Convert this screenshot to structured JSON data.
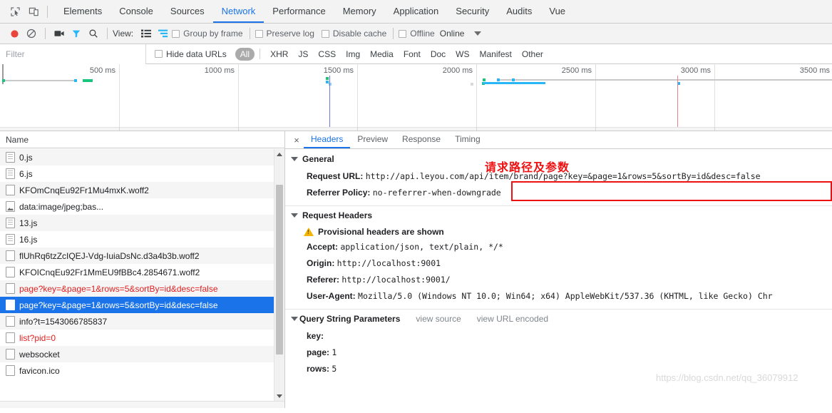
{
  "devtools": {
    "icons": {
      "inspect": "inspect-element-icon",
      "device": "device-toolbar-icon"
    },
    "tabs": [
      {
        "label": "Elements",
        "active": false
      },
      {
        "label": "Console",
        "active": false
      },
      {
        "label": "Sources",
        "active": false
      },
      {
        "label": "Network",
        "active": true
      },
      {
        "label": "Performance",
        "active": false
      },
      {
        "label": "Memory",
        "active": false
      },
      {
        "label": "Application",
        "active": false
      },
      {
        "label": "Security",
        "active": false
      },
      {
        "label": "Audits",
        "active": false
      },
      {
        "label": "Vue",
        "active": false
      }
    ]
  },
  "controlbar": {
    "record_icon": "record-icon",
    "clear_icon": "clear-icon",
    "camera_icon": "capture-screenshots-icon",
    "filter_icon": "filter-icon",
    "search_icon": "search-icon",
    "view_label": "View:",
    "view_list_icon": "list-view-icon",
    "view_waterfall_icon": "waterfall-view-icon",
    "group_by_frame": "Group by frame",
    "preserve_log": "Preserve log",
    "disable_cache": "Disable cache",
    "offline": "Offline",
    "online": "Online",
    "throttle_caret_icon": "chevron-down-icon"
  },
  "filterbar": {
    "placeholder": "Filter",
    "value": "",
    "hide_data_urls": "Hide data URLs",
    "types": [
      {
        "label": "All",
        "selected": true
      },
      {
        "label": "XHR",
        "selected": false
      },
      {
        "label": "JS",
        "selected": false
      },
      {
        "label": "CSS",
        "selected": false
      },
      {
        "label": "Img",
        "selected": false
      },
      {
        "label": "Media",
        "selected": false
      },
      {
        "label": "Font",
        "selected": false
      },
      {
        "label": "Doc",
        "selected": false
      },
      {
        "label": "WS",
        "selected": false
      },
      {
        "label": "Manifest",
        "selected": false
      },
      {
        "label": "Other",
        "selected": false
      }
    ]
  },
  "overview": {
    "ticks": [
      "500 ms",
      "1000 ms",
      "1500 ms",
      "2000 ms",
      "2500 ms",
      "3000 ms",
      "3500 ms"
    ]
  },
  "requests": {
    "column_header": "Name",
    "rows": [
      {
        "name": "0.js",
        "icon": "js-file-icon",
        "error": false,
        "selected": false
      },
      {
        "name": "6.js",
        "icon": "js-file-icon",
        "error": false,
        "selected": false
      },
      {
        "name": "KFOmCnqEu92Fr1Mu4mxK.woff2",
        "icon": "font-file-icon",
        "error": false,
        "selected": false
      },
      {
        "name": "data:image/jpeg;bas...",
        "icon": "image-file-icon",
        "error": false,
        "selected": false
      },
      {
        "name": "13.js",
        "icon": "js-file-icon",
        "error": false,
        "selected": false
      },
      {
        "name": "16.js",
        "icon": "js-file-icon",
        "error": false,
        "selected": false
      },
      {
        "name": "flUhRq6tzZcIQEJ-Vdg-IuiaDsNc.d3a4b3b.woff2",
        "icon": "font-file-icon",
        "error": false,
        "selected": false
      },
      {
        "name": "KFOICnqEu92Fr1MmEU9fBBc4.2854671.woff2",
        "icon": "font-file-icon",
        "error": false,
        "selected": false
      },
      {
        "name": "page?key=&page=1&rows=5&sortBy=id&desc=false",
        "icon": "xhr-file-icon",
        "error": true,
        "selected": false
      },
      {
        "name": "page?key=&page=1&rows=5&sortBy=id&desc=false",
        "icon": "xhr-file-icon",
        "error": true,
        "selected": true
      },
      {
        "name": "info?t=1543066785837",
        "icon": "xhr-file-icon",
        "error": false,
        "selected": false
      },
      {
        "name": "list?pid=0",
        "icon": "xhr-file-icon",
        "error": true,
        "selected": false
      },
      {
        "name": "websocket",
        "icon": "ws-file-icon",
        "error": false,
        "selected": false
      },
      {
        "name": "favicon.ico",
        "icon": "image-file-icon",
        "error": false,
        "selected": false
      }
    ]
  },
  "detail": {
    "close_label": "×",
    "tabs": [
      {
        "label": "Headers",
        "active": true
      },
      {
        "label": "Preview",
        "active": false
      },
      {
        "label": "Response",
        "active": false
      },
      {
        "label": "Timing",
        "active": false
      }
    ],
    "general": {
      "title": "General",
      "request_url_key": "Request URL:",
      "request_url_value": "http://api.leyou.com/api/item/brand/page?key=&page=1&rows=5&sortBy=id&desc=false",
      "referrer_policy_key": "Referrer Policy:",
      "referrer_policy_value": "no-referrer-when-downgrade"
    },
    "request_headers": {
      "title": "Request Headers",
      "provisional_warning": "Provisional headers are shown",
      "warning_icon": "warning-triangle-icon",
      "items": [
        {
          "key": "Accept:",
          "value": "application/json, text/plain, */*"
        },
        {
          "key": "Origin:",
          "value": "http://localhost:9001"
        },
        {
          "key": "Referer:",
          "value": "http://localhost:9001/"
        },
        {
          "key": "User-Agent:",
          "value": "Mozilla/5.0 (Windows NT 10.0; Win64; x64) AppleWebKit/537.36 (KHTML, like Gecko) Chr"
        }
      ]
    },
    "query_string": {
      "title": "Query String Parameters",
      "view_source": "view source",
      "view_url_encoded": "view URL encoded",
      "items": [
        {
          "key": "key:",
          "value": ""
        },
        {
          "key": "page:",
          "value": "1"
        },
        {
          "key": "rows:",
          "value": "5"
        }
      ]
    }
  },
  "annotation": {
    "text": "请求路径及参数",
    "color": "#ee1111"
  },
  "watermark": {
    "text": "https://blog.csdn.net/qq_36079912"
  }
}
